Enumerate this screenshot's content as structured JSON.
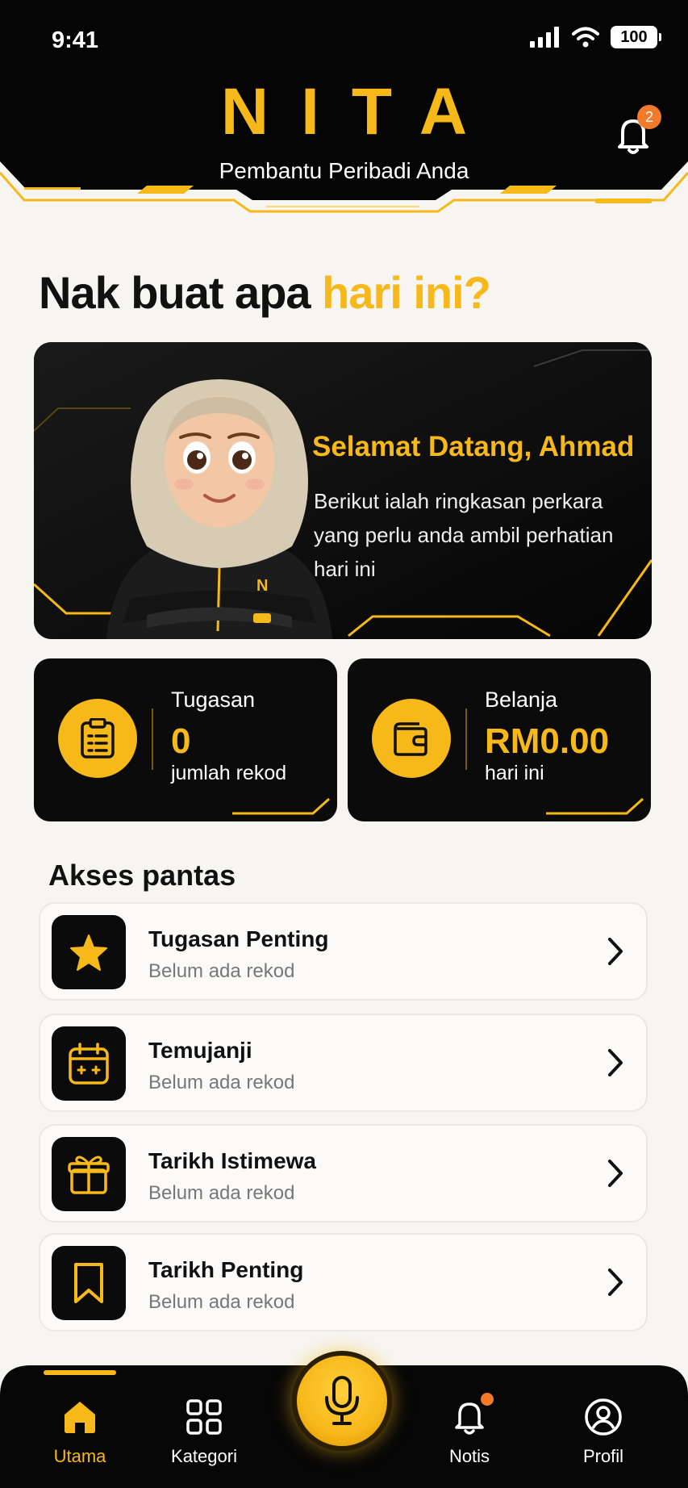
{
  "status_bar": {
    "time": "9:41",
    "battery": "100"
  },
  "header": {
    "logo": "NITA",
    "tagline": "Pembantu Peribadi Anda",
    "notification_count": "2"
  },
  "heading": {
    "part1": "Nak buat apa ",
    "part2": "hari ini?"
  },
  "welcome": {
    "title": "Selamat Datang, Ahmad",
    "body": "Berikut ialah ringkasan perkara yang perlu anda ambil perhatian hari ini"
  },
  "stats": [
    {
      "label": "Tugasan",
      "value": "0",
      "sub": "jumlah rekod",
      "icon": "clipboard-icon"
    },
    {
      "label": "Belanja",
      "value": "RM0.00",
      "sub": "hari ini",
      "icon": "wallet-icon"
    }
  ],
  "quick_access": {
    "title": "Akses pantas",
    "items": [
      {
        "name": "Tugasan Penting",
        "sub": "Belum ada rekod",
        "icon": "star-icon"
      },
      {
        "name": "Temujanji",
        "sub": "Belum ada rekod",
        "icon": "calendar-icon"
      },
      {
        "name": "Tarikh Istimewa",
        "sub": "Belum ada rekod",
        "icon": "gift-icon"
      },
      {
        "name": "Tarikh Penting",
        "sub": "Belum ada rekod",
        "icon": "bookmark-icon"
      }
    ]
  },
  "nav": {
    "items": [
      {
        "label": "Utama",
        "icon": "home-icon",
        "active": true
      },
      {
        "label": "Kategori",
        "icon": "grid-icon",
        "active": false
      },
      {
        "label": "Notis",
        "icon": "bell-icon",
        "active": false
      },
      {
        "label": "Profil",
        "icon": "user-icon",
        "active": false
      }
    ],
    "mic": "mic-icon"
  },
  "colors": {
    "accent": "#f7b81a",
    "dark": "#0b0b0b",
    "badge": "#f47a2b",
    "background": "#f7f5f2"
  }
}
